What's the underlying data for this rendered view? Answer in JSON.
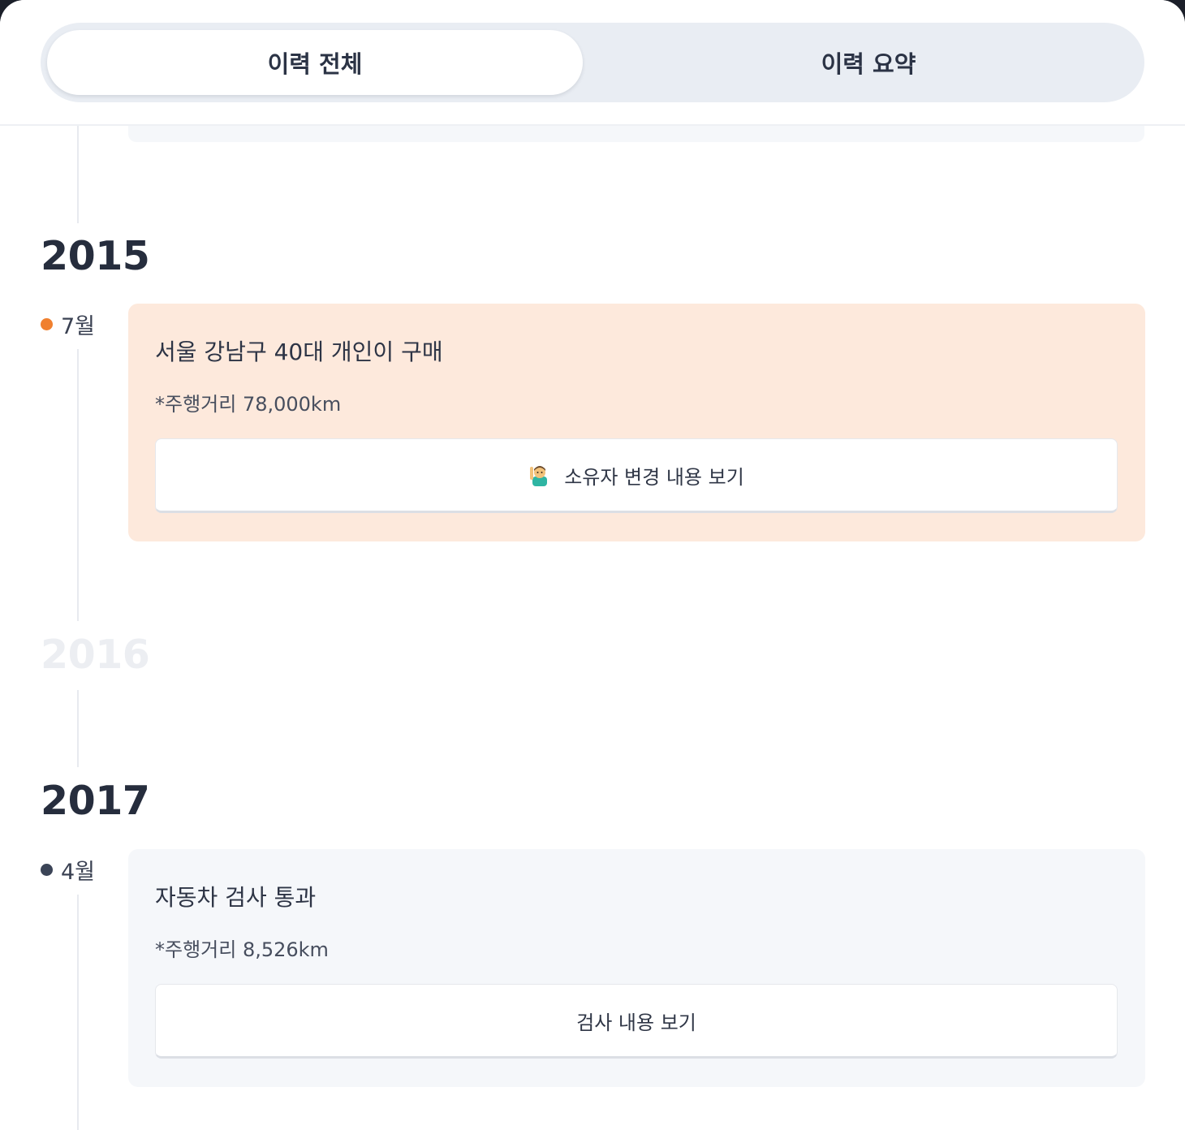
{
  "tabs": {
    "all_history": "이력 전체",
    "summary": "이력 요약"
  },
  "timeline": {
    "year_2015": "2015",
    "year_2016": "2016",
    "year_2017": "2017",
    "entry_2015_jul": {
      "month": "7월",
      "dot_color": "#f0802f",
      "title": "서울 강남구 40대 개인이 구매",
      "mileage": "*주행거리 78,000km",
      "button_label": "소유자 변경 내용 보기",
      "button_icon": "person-raising-hand-icon",
      "card_color": "#fde9dc"
    },
    "entry_2017_apr": {
      "month": "4월",
      "dot_color": "#3b4457",
      "title": "자동차 검사 통과",
      "mileage": "*주행거리 8,526km",
      "button_label": "검사 내용 보기",
      "card_color": "#f5f7fa"
    }
  }
}
